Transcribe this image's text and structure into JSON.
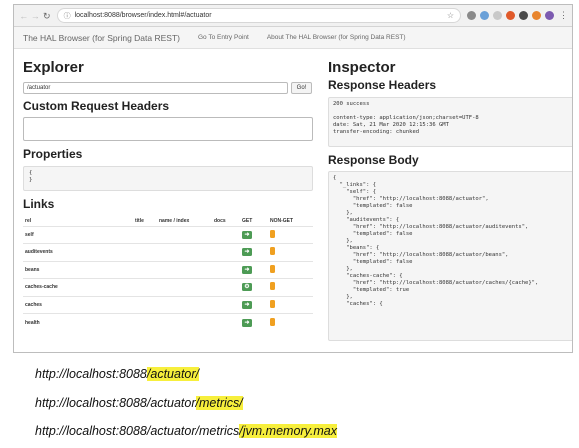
{
  "browser": {
    "url": "localhost:8088/browser/index.html#/actuator",
    "colors": {
      "toolbar_bg": "#f1f1f1"
    }
  },
  "navbar": {
    "brand": "The HAL Browser (for Spring Data REST)",
    "links": [
      "Go To Entry Point",
      "About The HAL Browser (for Spring Data REST)"
    ]
  },
  "explorer": {
    "title": "Explorer",
    "url_value": "/actuator",
    "go_label": "Go!",
    "custom_headers_title": "Custom Request Headers",
    "properties_title": "Properties",
    "properties_text": "{\n}",
    "links_title": "Links",
    "links_columns": [
      "rel",
      "title",
      "name / index",
      "docs",
      "GET",
      "NON-GET"
    ],
    "links_rows": [
      {
        "rel": "self",
        "get_icon": "arrow-right-icon"
      },
      {
        "rel": "auditevents",
        "get_icon": "arrow-right-icon"
      },
      {
        "rel": "beans",
        "get_icon": "arrow-right-icon"
      },
      {
        "rel": "caches-cache",
        "get_icon": "gear-icon"
      },
      {
        "rel": "caches",
        "get_icon": "arrow-right-icon"
      },
      {
        "rel": "health",
        "get_icon": "arrow-right-icon"
      }
    ]
  },
  "inspector": {
    "title": "Inspector",
    "response_headers_title": "Response Headers",
    "status_line": "200 success",
    "headers": [
      "content-type: application/json;charset=UTF-8",
      "date: Sat, 21 Mar 2020 12:15:36 GMT",
      "transfer-encoding: chunked"
    ],
    "response_body_title": "Response Body",
    "response_body": "{\n  \"_links\": {\n    \"self\": {\n      \"href\": \"http://localhost:8088/actuator\",\n      \"templated\": false\n    },\n    \"auditevents\": {\n      \"href\": \"http://localhost:8088/actuator/auditevents\",\n      \"templated\": false\n    },\n    \"beans\": {\n      \"href\": \"http://localhost:8088/actuator/beans\",\n      \"templated\": false\n    },\n    \"caches-cache\": {\n      \"href\": \"http://localhost:8088/actuator/caches/{cache}\",\n      \"templated\": true\n    },\n    \"caches\": {"
  },
  "annotations": [
    {
      "prefix": "http://localhost:8088",
      "highlight": "/actuator/"
    },
    {
      "prefix": "http://localhost:8088/actuator",
      "highlight": "/metrics/"
    },
    {
      "prefix": "http://localhost:8088/actuator/metrics",
      "highlight": "/jvm.memory.max"
    }
  ],
  "colors": {
    "highlight": "#f7ef3c",
    "get_button": "#4d9b55",
    "non_get_button": "#f0a020"
  }
}
